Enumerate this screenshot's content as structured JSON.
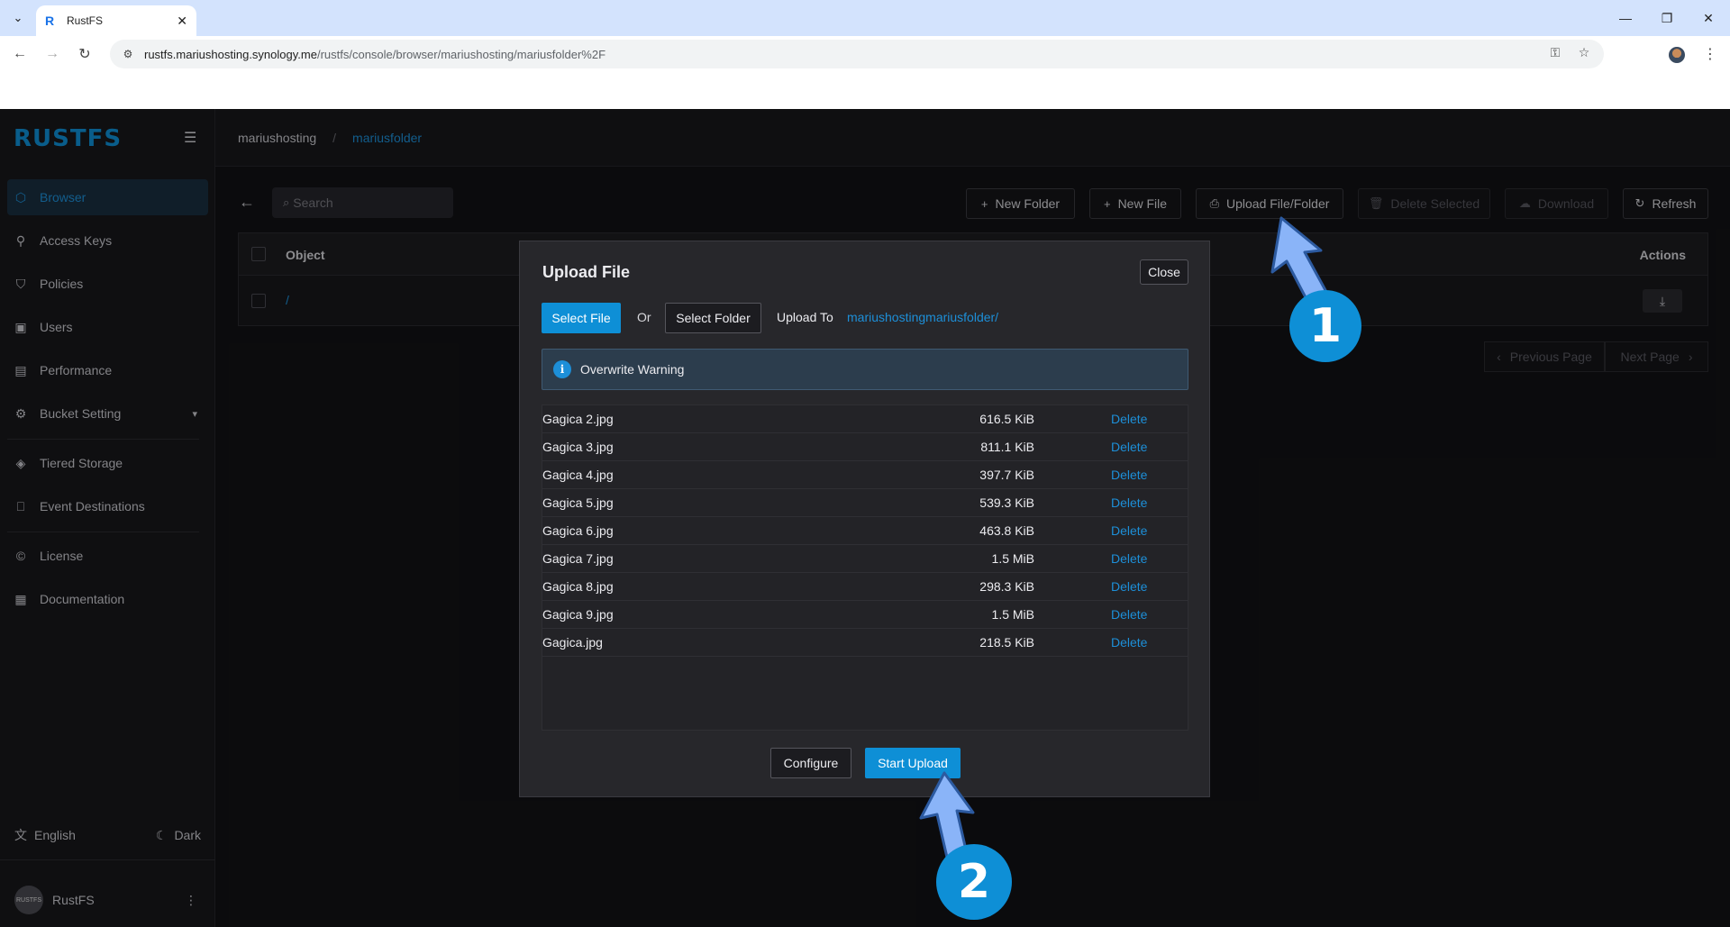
{
  "browser": {
    "tab_title": "RustFS",
    "tab_favicon": "R",
    "url_host": "rustfs.mariushosting.synology.me",
    "url_path": "/rustfs/console/browser/mariushosting/mariusfolder%2F"
  },
  "sidebar": {
    "brand": "RUSTFS",
    "items": [
      {
        "label": "Browser",
        "icon": "cube-icon",
        "active": true
      },
      {
        "label": "Access Keys",
        "icon": "key-icon"
      },
      {
        "label": "Policies",
        "icon": "shield-icon"
      },
      {
        "label": "Users",
        "icon": "user-icon"
      },
      {
        "label": "Performance",
        "icon": "chart-icon"
      },
      {
        "label": "Bucket Setting",
        "icon": "gear-icon"
      },
      {
        "label": "Tiered Storage",
        "icon": "layers-icon"
      },
      {
        "label": "Event Destinations",
        "icon": "bookmark-icon"
      },
      {
        "label": "License",
        "icon": "copyright-icon"
      },
      {
        "label": "Documentation",
        "icon": "doc-icon"
      }
    ],
    "language": "English",
    "theme": "Dark",
    "user": "RustFS",
    "avatar_text": "RUSTFS"
  },
  "header": {
    "crumb_root": "mariushosting",
    "crumb_sep": "/",
    "crumb_current": "mariusfolder"
  },
  "toolbar": {
    "search_placeholder": "Search",
    "new_folder": "New Folder",
    "new_file": "New File",
    "upload": "Upload File/Folder",
    "delete_selected": "Delete Selected",
    "download": "Download",
    "refresh": "Refresh"
  },
  "table": {
    "col_object": "Object",
    "col_actions": "Actions",
    "rows": [
      {
        "name": "/"
      }
    ]
  },
  "pager": {
    "previous": "Previous Page",
    "next": "Next Page"
  },
  "modal": {
    "title": "Upload File",
    "close": "Close",
    "select_file": "Select File",
    "or": "Or",
    "select_folder": "Select Folder",
    "upload_to_label": "Upload To",
    "upload_to_path": "mariushostingmariusfolder/",
    "warning": "Overwrite Warning",
    "delete_label": "Delete",
    "files": [
      {
        "name": "Gagica 2.jpg",
        "size": "616.5 KiB"
      },
      {
        "name": "Gagica 3.jpg",
        "size": "811.1 KiB"
      },
      {
        "name": "Gagica 4.jpg",
        "size": "397.7 KiB"
      },
      {
        "name": "Gagica 5.jpg",
        "size": "539.3 KiB"
      },
      {
        "name": "Gagica 6.jpg",
        "size": "463.8 KiB"
      },
      {
        "name": "Gagica 7.jpg",
        "size": "1.5 MiB"
      },
      {
        "name": "Gagica 8.jpg",
        "size": "298.3 KiB"
      },
      {
        "name": "Gagica 9.jpg",
        "size": "1.5 MiB"
      },
      {
        "name": "Gagica.jpg",
        "size": "218.5 KiB"
      }
    ],
    "configure": "Configure",
    "start_upload": "Start Upload"
  },
  "annotations": {
    "step1": "1",
    "step2": "2"
  },
  "colors": {
    "accent": "#0e8fd6",
    "arrow": "#8ab4f8"
  }
}
